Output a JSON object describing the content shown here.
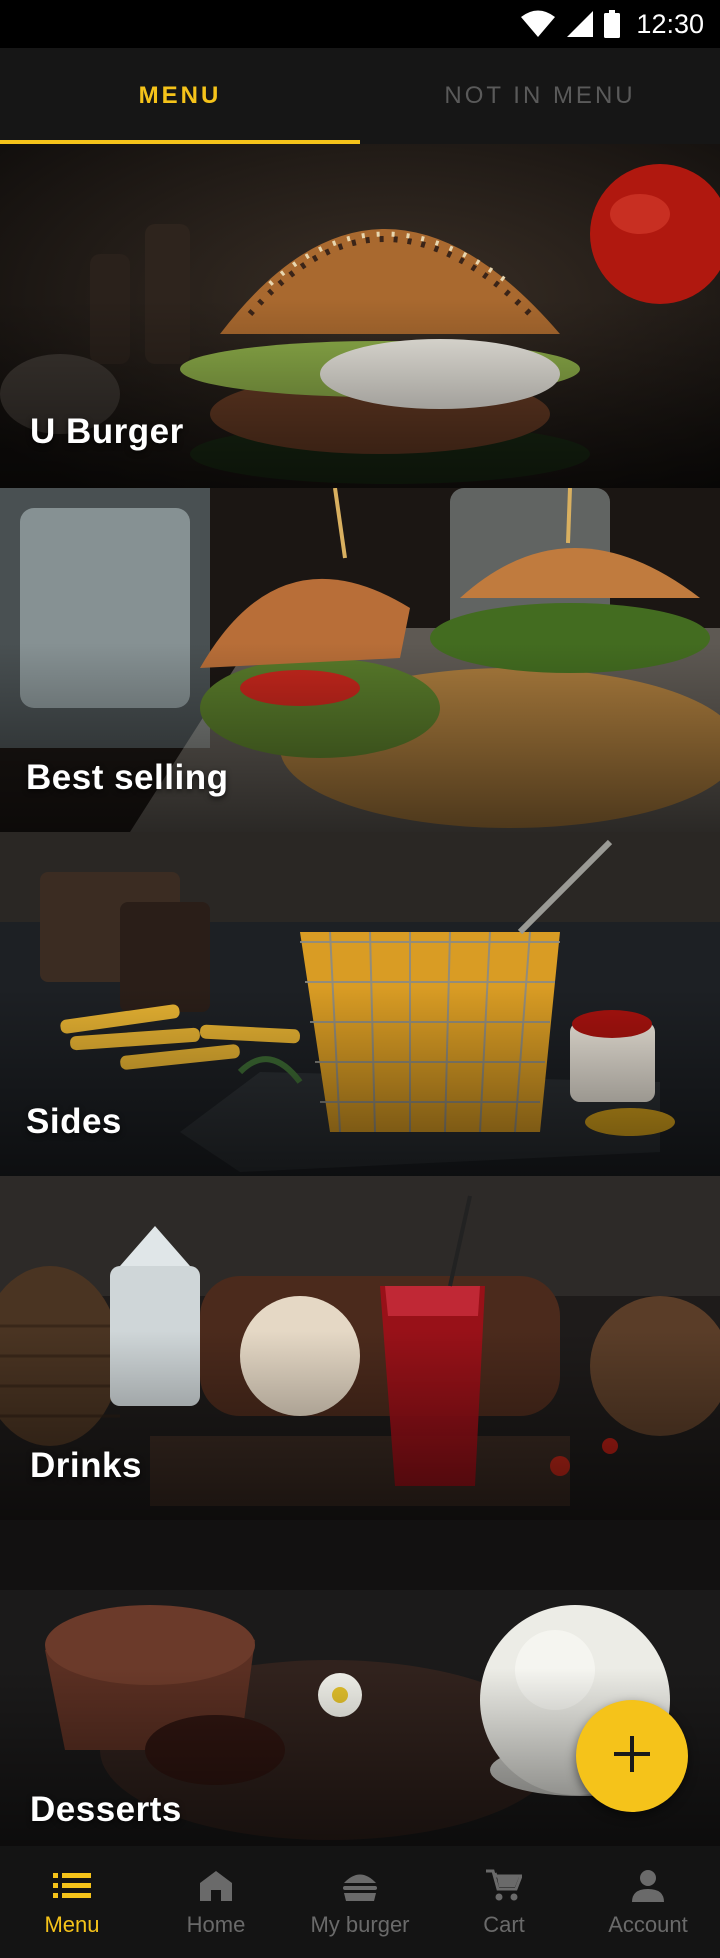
{
  "status_bar": {
    "time": "12:30"
  },
  "tabs": [
    {
      "label": "MENU",
      "active": true
    },
    {
      "label": "NOT IN MENU",
      "active": false
    }
  ],
  "categories": [
    {
      "label": "U Burger",
      "image": "burger-photo"
    },
    {
      "label": "Best selling",
      "image": "burgers-fries-photo"
    },
    {
      "label": "Sides",
      "image": "fries-basket-photo"
    },
    {
      "label": "Drinks",
      "image": "red-drink-photo"
    },
    {
      "label": "Desserts",
      "image": "lava-cake-icecream-photo"
    }
  ],
  "fab": {
    "icon": "plus-icon"
  },
  "bottom_nav": [
    {
      "label": "Menu",
      "icon": "list-icon",
      "active": true
    },
    {
      "label": "Home",
      "icon": "home-icon",
      "active": false
    },
    {
      "label": "My burger",
      "icon": "burger-icon",
      "active": false
    },
    {
      "label": "Cart",
      "icon": "cart-icon",
      "active": false
    },
    {
      "label": "Account",
      "icon": "person-icon",
      "active": false
    }
  ],
  "colors": {
    "accent": "#F5C31A",
    "inactive": "#6a6a6a",
    "background": "#111111"
  }
}
